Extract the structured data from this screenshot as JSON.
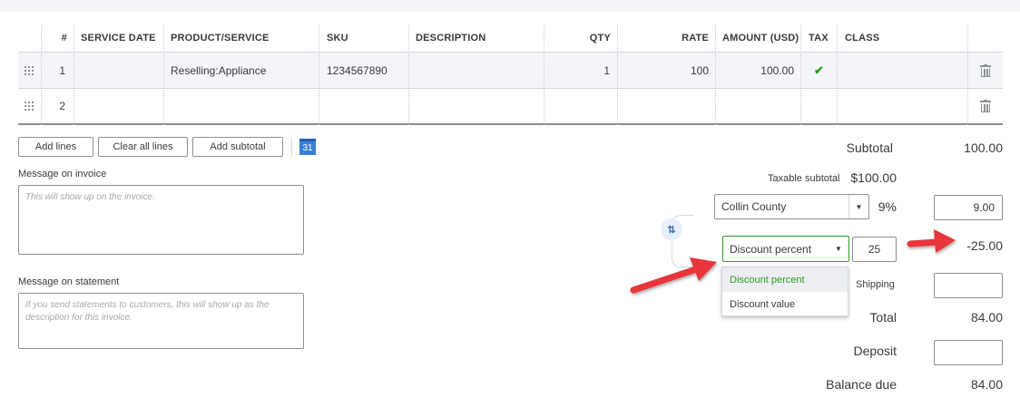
{
  "table": {
    "headers": [
      "#",
      "SERVICE DATE",
      "PRODUCT/SERVICE",
      "SKU",
      "DESCRIPTION",
      "QTY",
      "RATE",
      "AMOUNT (USD)",
      "TAX",
      "CLASS"
    ],
    "rows": [
      {
        "num": "1",
        "service_date": "",
        "product": "Reselling:Appliance",
        "sku": "1234567890",
        "description": "",
        "qty": "1",
        "rate": "100",
        "amount": "100.00",
        "tax": "✔",
        "class": ""
      },
      {
        "num": "2",
        "service_date": "",
        "product": "",
        "sku": "",
        "description": "",
        "qty": "",
        "rate": "",
        "amount": "",
        "tax": "",
        "class": ""
      }
    ]
  },
  "actions": {
    "add_lines": "Add lines",
    "clear_all_lines": "Clear all lines",
    "add_subtotal": "Add subtotal",
    "calendar_day": "31"
  },
  "messages": {
    "invoice_label": "Message on invoice",
    "invoice_placeholder": "This will show up on the invoice.",
    "statement_label": "Message on statement",
    "statement_placeholder": "If you send statements to customers, this will show up as the description for this invoice."
  },
  "totals": {
    "subtotal_label": "Subtotal",
    "subtotal_value": "100.00",
    "taxable_subtotal_label": "Taxable subtotal",
    "taxable_subtotal_value": "$100.00",
    "tax_rate_select": "Collin County",
    "tax_rate_percent": "9%",
    "tax_amount": "9.00",
    "discount_type": "Discount percent",
    "discount_input": "25",
    "discount_value": "-25.00",
    "discount_options": [
      "Discount percent",
      "Discount value"
    ],
    "shipping_label": "Shipping",
    "shipping_value": "",
    "total_label": "Total",
    "total_value": "84.00",
    "deposit_label": "Deposit",
    "deposit_value": "",
    "balance_due_label": "Balance due",
    "balance_due_value": "84.00"
  },
  "colors": {
    "accent_green": "#2ca01c",
    "arrow_red": "#e8363a"
  }
}
